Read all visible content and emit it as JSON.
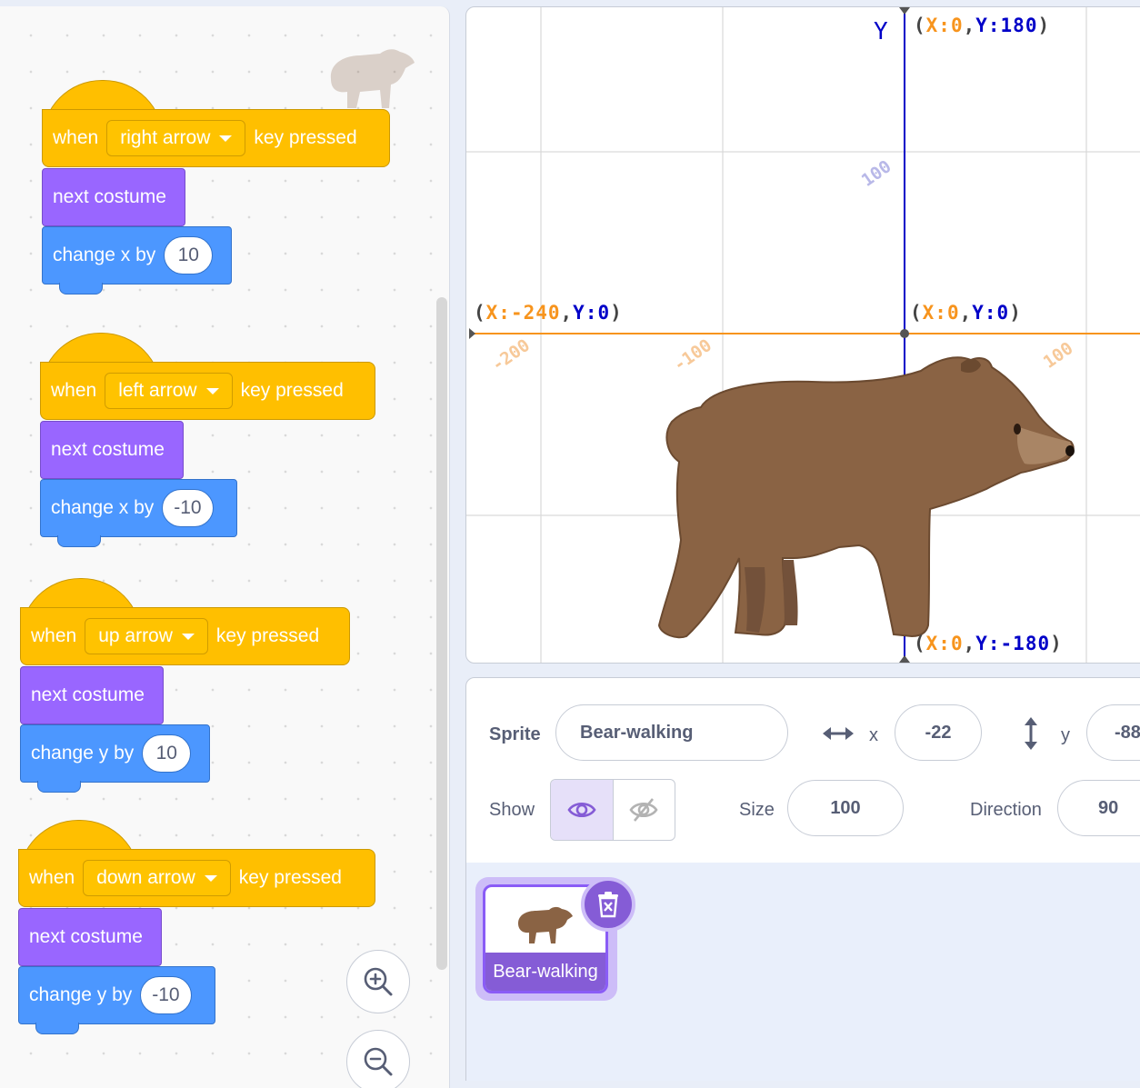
{
  "scripts": [
    {
      "hat": {
        "when": "when",
        "key": "right arrow",
        "suffix": "key pressed"
      },
      "costume": "next costume",
      "motion": {
        "label": "change x by",
        "value": "10"
      }
    },
    {
      "hat": {
        "when": "when",
        "key": "left arrow",
        "suffix": "key pressed"
      },
      "costume": "next costume",
      "motion": {
        "label": "change x by",
        "value": "-10"
      }
    },
    {
      "hat": {
        "when": "when",
        "key": "up arrow",
        "suffix": "key pressed"
      },
      "costume": "next costume",
      "motion": {
        "label": "change y by",
        "value": "10"
      }
    },
    {
      "hat": {
        "when": "when",
        "key": "down arrow",
        "suffix": "key pressed"
      },
      "costume": "next costume",
      "motion": {
        "label": "change y by",
        "value": "-10"
      }
    }
  ],
  "stage": {
    "axis_y_label": "Y",
    "top_coord": {
      "x": "X:0",
      "y": "Y:180"
    },
    "left_coord": {
      "x": "X:-240",
      "y": "Y:0"
    },
    "origin_coord": {
      "x": "X:0",
      "y": "Y:0"
    },
    "bottom_coord": {
      "x": "X:0",
      "y": "Y:-180"
    },
    "x_ticks": [
      "-200",
      "-100",
      "100"
    ],
    "y_ticks": [
      "100"
    ],
    "colors": {
      "x_axis": "#f7941d",
      "y_axis": "#0000c8",
      "grid": "#d9d9d9"
    }
  },
  "sprite_info": {
    "sprite_label": "Sprite",
    "sprite_name": "Bear-walking",
    "x_label": "x",
    "x_value": "-22",
    "y_label": "y",
    "y_value": "-88",
    "show_label": "Show",
    "size_label": "Size",
    "size_value": "100",
    "direction_label": "Direction",
    "direction_value": "90"
  },
  "sprite_list": {
    "items": [
      {
        "name": "Bear-walking",
        "selected": true
      }
    ]
  },
  "icons": {
    "zoom_in": "zoom-in-icon",
    "zoom_out": "zoom-out-icon",
    "delete": "trash-icon",
    "show": "eye-icon",
    "hide": "eye-slash-icon"
  },
  "colors": {
    "events": "#ffbf00",
    "looks": "#9966ff",
    "motion": "#4c97ff",
    "selection": "#855cd6"
  }
}
